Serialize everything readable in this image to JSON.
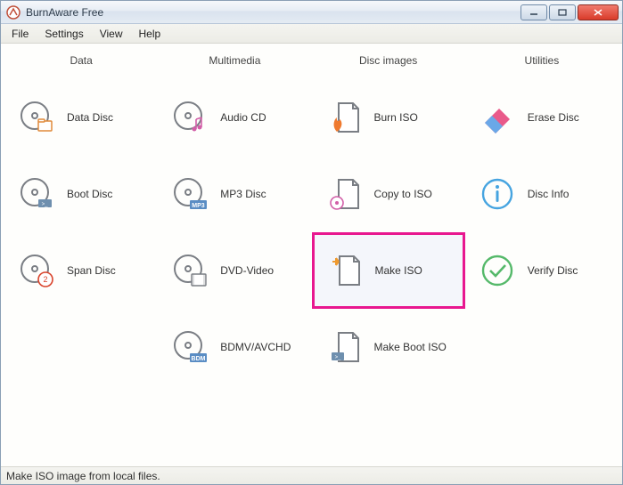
{
  "window": {
    "title": "BurnAware Free"
  },
  "menu": {
    "items": [
      "File",
      "Settings",
      "View",
      "Help"
    ]
  },
  "columns": [
    {
      "header": "Data",
      "items": [
        {
          "id": "data-disc",
          "label": "Data Disc",
          "icon": "disc-folder-icon"
        },
        {
          "id": "boot-disc",
          "label": "Boot Disc",
          "icon": "disc-boot-icon"
        },
        {
          "id": "span-disc",
          "label": "Span Disc",
          "icon": "disc-span-icon"
        }
      ]
    },
    {
      "header": "Multimedia",
      "items": [
        {
          "id": "audio-cd",
          "label": "Audio CD",
          "icon": "disc-music-icon"
        },
        {
          "id": "mp3-disc",
          "label": "MP3 Disc",
          "icon": "disc-mp3-icon"
        },
        {
          "id": "dvd-video",
          "label": "DVD-Video",
          "icon": "disc-video-icon"
        },
        {
          "id": "bdmv-avchd",
          "label": "BDMV/AVCHD",
          "icon": "disc-bdm-icon"
        }
      ]
    },
    {
      "header": "Disc images",
      "items": [
        {
          "id": "burn-iso",
          "label": "Burn ISO",
          "icon": "page-fire-icon"
        },
        {
          "id": "copy-to-iso",
          "label": "Copy to ISO",
          "icon": "page-copy-icon"
        },
        {
          "id": "make-iso",
          "label": "Make ISO",
          "icon": "page-star-icon",
          "selected": true
        },
        {
          "id": "make-boot-iso",
          "label": "Make Boot ISO",
          "icon": "page-boot-icon"
        }
      ]
    },
    {
      "header": "Utilities",
      "items": [
        {
          "id": "erase-disc",
          "label": "Erase Disc",
          "icon": "eraser-icon"
        },
        {
          "id": "disc-info",
          "label": "Disc Info",
          "icon": "info-icon"
        },
        {
          "id": "verify-disc",
          "label": "Verify Disc",
          "icon": "check-icon"
        }
      ]
    }
  ],
  "statusbar": {
    "text": "Make ISO image from local files."
  },
  "colors": {
    "accent": "#e8178f",
    "disc_stroke": "#7a7e84"
  }
}
